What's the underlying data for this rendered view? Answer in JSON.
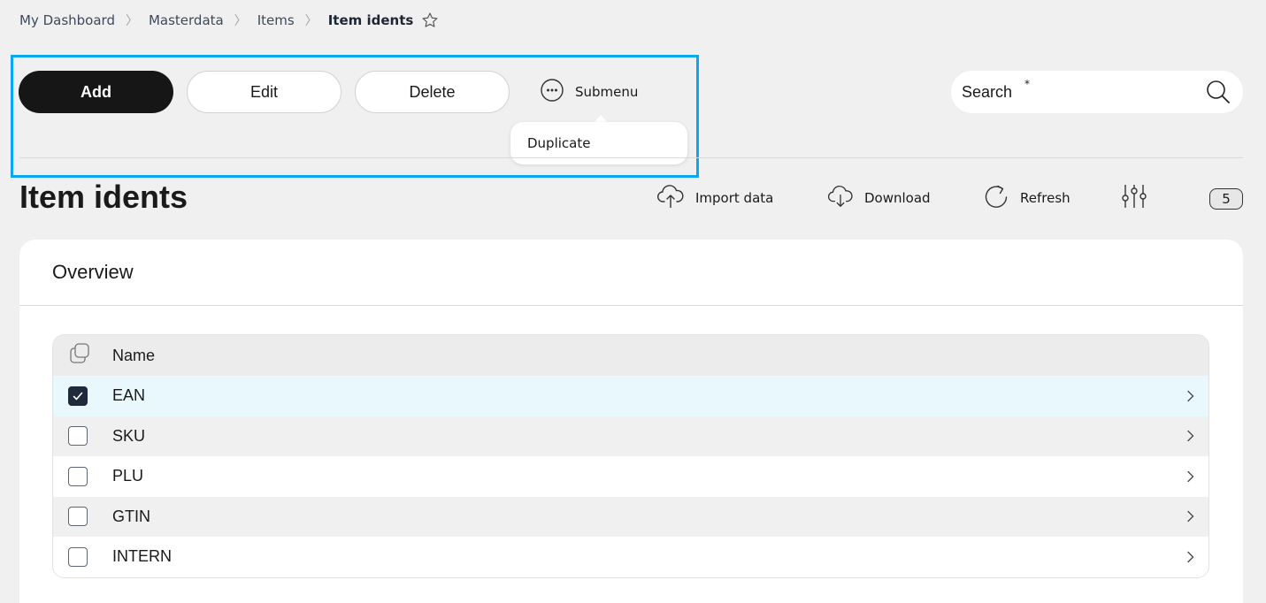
{
  "breadcrumb": {
    "items": [
      "My Dashboard",
      "Masterdata",
      "Items"
    ],
    "current": "Item idents"
  },
  "toolbar": {
    "add_label": "Add",
    "edit_label": "Edit",
    "delete_label": "Delete",
    "submenu_label": "Submenu",
    "submenu_items": [
      "Duplicate"
    ]
  },
  "search": {
    "placeholder": "Search",
    "required_marker": "*"
  },
  "page": {
    "title": "Item idents"
  },
  "actions": {
    "import_label": "Import data",
    "download_label": "Download",
    "refresh_label": "Refresh",
    "count": "5"
  },
  "card": {
    "title": "Overview",
    "table": {
      "header_name": "Name",
      "rows": [
        {
          "name": "EAN",
          "checked": true
        },
        {
          "name": "SKU",
          "checked": false
        },
        {
          "name": "PLU",
          "checked": false
        },
        {
          "name": "GTIN",
          "checked": false
        },
        {
          "name": "INTERN",
          "checked": false
        }
      ]
    }
  },
  "icons": {
    "star": "star-outline-icon",
    "submenu": "ellipsis-circle-icon",
    "search": "magnifier-icon",
    "import": "cloud-upload-icon",
    "download": "cloud-download-icon",
    "refresh": "refresh-icon",
    "filter": "sliders-icon",
    "select_all": "copy-icon",
    "chevron": "chevron-right-icon"
  },
  "colors": {
    "accent_frame": "#08a8ef",
    "primary_button": "#161616",
    "selected_row": "#e8f8fd"
  }
}
